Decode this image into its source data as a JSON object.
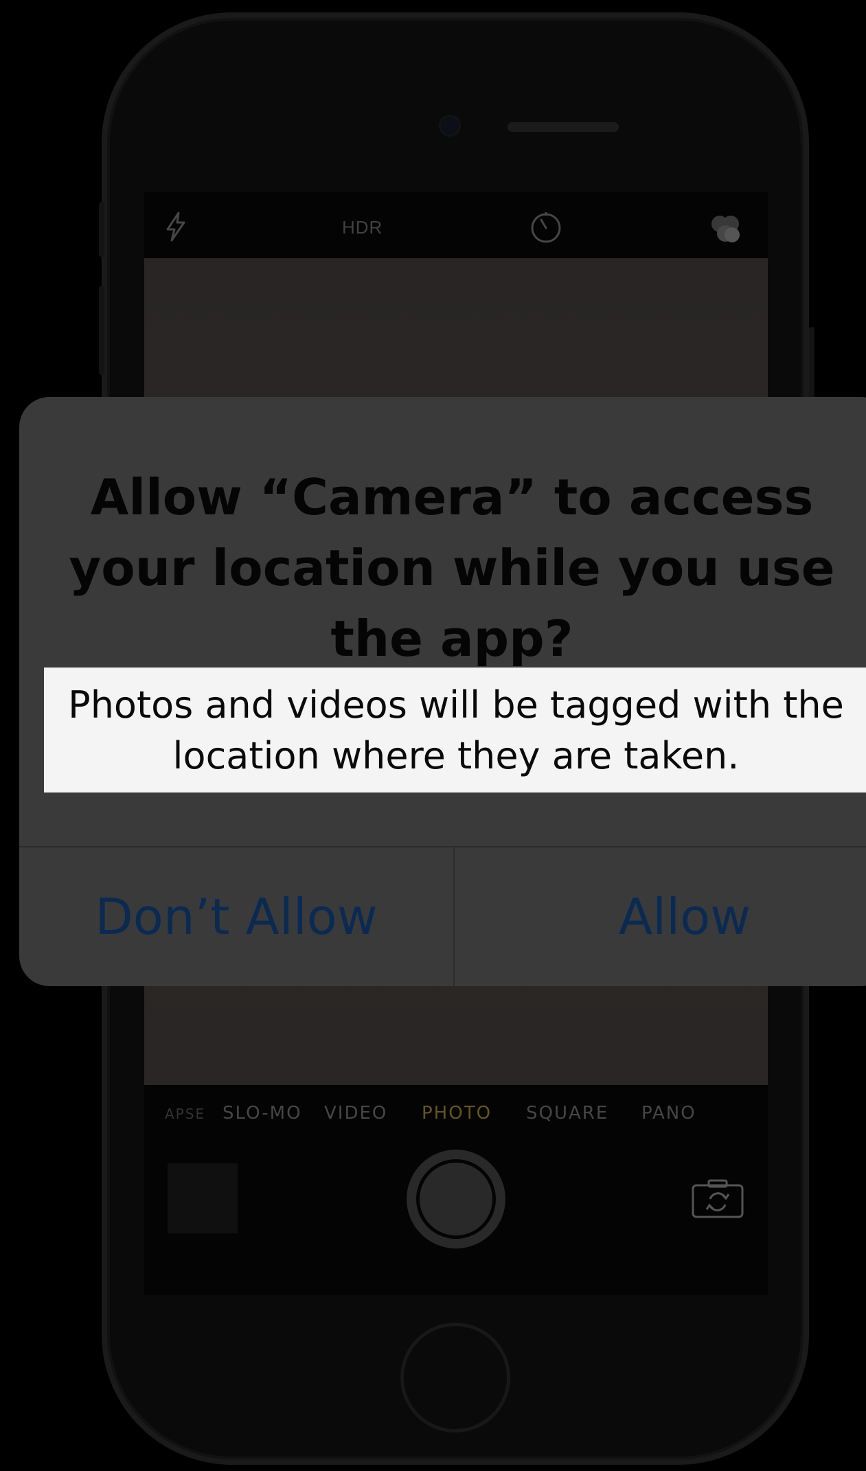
{
  "camera": {
    "hdr_label": "HDR",
    "modes": [
      "APSE",
      "SLO-MO",
      "VIDEO",
      "PHOTO",
      "SQUARE",
      "PANO"
    ],
    "active_mode": "PHOTO",
    "icons": [
      "flash-icon",
      "timer-icon",
      "filters-icon",
      "shutter-button",
      "flip-camera-icon"
    ]
  },
  "alert": {
    "title": "Allow “Camera” to access your location while you use the app?",
    "message": "Photos and videos will be tagged with the location where they are taken.",
    "buttons": {
      "dont_allow": "Don’t Allow",
      "allow": "Allow"
    }
  },
  "colors": {
    "alert_background": "#3a3a3a",
    "button_text": "#0b2a52",
    "message_highlight": "#f4f4f4",
    "active_mode": "#6b5a24"
  }
}
